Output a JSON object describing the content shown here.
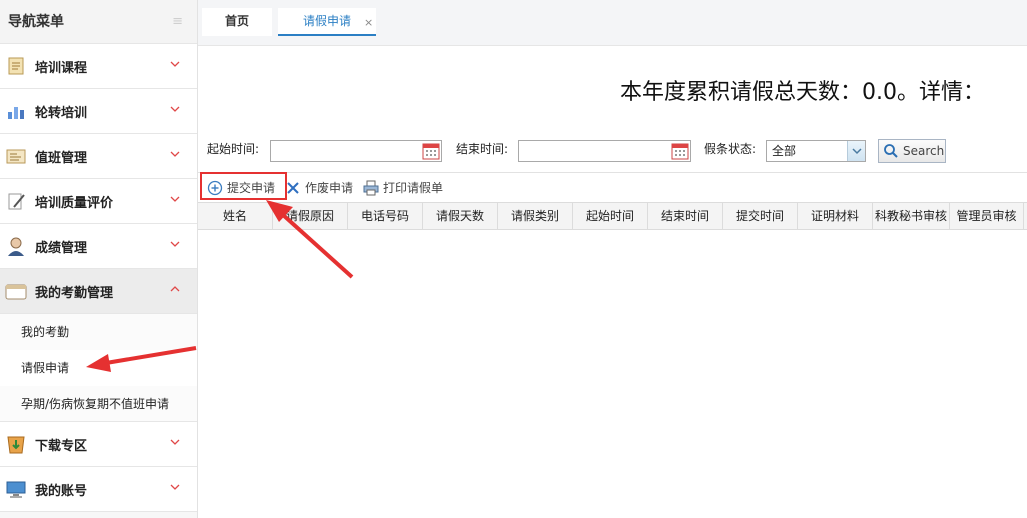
{
  "sidebar": {
    "title": "导航菜单",
    "collapse_glyph": "≡",
    "items": [
      {
        "label": "培训课程",
        "icon": "scroll-icon"
      },
      {
        "label": "轮转培训",
        "icon": "chart-icon"
      },
      {
        "label": "值班管理",
        "icon": "id-card-icon"
      },
      {
        "label": "培训质量评价",
        "icon": "pen-icon"
      },
      {
        "label": "成绩管理",
        "icon": "user-icon"
      },
      {
        "label": "我的考勤管理",
        "icon": "calendar-icon",
        "expanded": true
      },
      {
        "label": "下载专区",
        "icon": "download-icon"
      },
      {
        "label": "我的账号",
        "icon": "computer-icon"
      }
    ],
    "sub_items": [
      "我的考勤",
      "请假申请",
      "孕期/伤病恢复期不值班申请"
    ]
  },
  "tabs": {
    "home": "首页",
    "leave": "请假申请",
    "close": "×"
  },
  "summary": {
    "text": "本年度累积请假总天数：0.0。详情："
  },
  "filters": {
    "start_label": "起始时间:",
    "end_label": "结束时间:",
    "status_label": "假条状态:",
    "status_value": "全部",
    "search_label": "Search"
  },
  "toolbar": {
    "submit": "提交申请",
    "void": "作废申请",
    "print": "打印请假单"
  },
  "table": {
    "columns": [
      "姓名",
      "请假原因",
      "电话号码",
      "请假天数",
      "请假类别",
      "起始时间",
      "结束时间",
      "提交时间",
      "证明材料",
      "科教秘书审核",
      "管理员审核"
    ]
  },
  "colors": {
    "accent": "#2b7fc4",
    "annotation": "#e53131"
  }
}
